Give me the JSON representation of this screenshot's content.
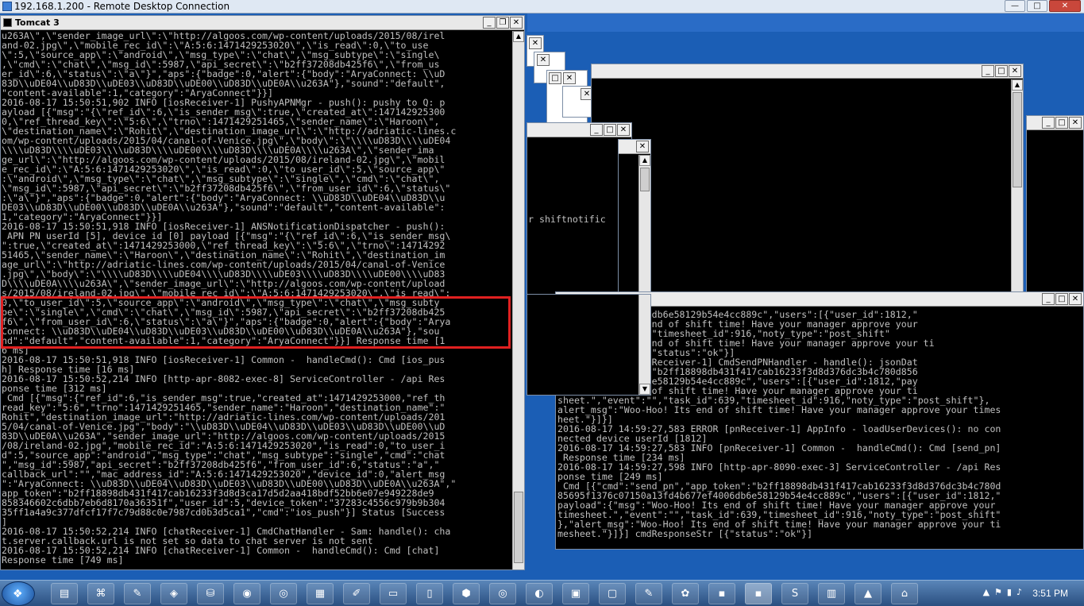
{
  "rdp": {
    "title": "192.168.1.200 - Remote Desktop Connection",
    "min_label": "—",
    "max_label": "□",
    "close_label": "✕"
  },
  "main_window": {
    "title": "Tomcat 3",
    "lines": [
      "u263A\\\",\\\"sender_image_url\\\":\\\"http://algoos.com/wp-content/uploads/2015/08/irel",
      "and-02.jpg\\\",\\\"mobile_rec_id\\\":\\\"A:5:6:1471429253020\\\",\\\"is_read\\\":0,\\\"to_use",
      "\\\":5,\\\"source_app\\\":\\\"android\\\",\\\"msg_type\\\":\\\"chat\\\",\\\"msg_subtype\\\":\\\"single\\",
      ",\\\"cmd\\\":\\\"chat\\\",\\\"msg_id\\\":5987,\\\"api_secret\\\":\\\"b2ff37208db425f6\\\",\\\"from_us",
      "er_id\\\":6,\\\"status\\\":\\\"a\\\"}\",\"aps\":{\"badge\":0,\"alert\":{\"body\":\"AryaConnect: \\\\uD",
      "83D\\\\uDE04\\\\uD83D\\\\uDE03\\\\uD83D\\\\uDE00\\\\uD83D\\\\uDE0A\\\\u263A\"},\"sound\":\"default\",",
      "\"content-available\":1,\"category\":\"AryaConnect\"}}]",
      "2016-08-17 15:50:51,902 INFO [iosReceiver-1] PushyAPNMgr - push(): pushy to Q: p",
      "ayload [{\"msg\":\"{\\\"ref_id\\\":6,\\\"is_sender_msg\\\":true,\\\"created_at\\\":147142925300",
      "0,\\\"ref_thread_key\\\":\\\"5:6\\\",\\\"trno\\\":1471429251465,\\\"sender_name\\\":\\\"Haroon\\\",",
      "\\\"destination_name\\\":\\\"Rohit\\\",\\\"destination_image_url\\\":\\\"http://adriatic-lines.c",
      "om/wp-content/uploads/2015/04/canal-of-Venice.jpg\\\",\\\"body\\\":\\\"\\\\\\\\uD83D\\\\\\\\uDE04",
      "\\\\\\\\uD83D\\\\\\\\uDE03\\\\\\\\uD83D\\\\\\\\uDE00\\\\\\\\uD83D\\\\\\\\uDE0A\\\\\\\\u263A\\\",\\\"sender_ima",
      "ge_url\\\":\\\"http://algoos.com/wp-content/uploads/2015/08/ireland-02.jpg\\\",\\\"mobil",
      "e_rec_id\\\":\\\"A:5:6:1471429253020\\\",\\\"is_read\\\":0,\\\"to_user_id\\\":5,\\\"source_app\\\"",
      ":\\\"android\\\",\\\"msg_type\\\":\\\"chat\\\",\\\"msg_subtype\\\":\\\"single\\\",\\\"cmd\\\":\\\"chat\\\",",
      "\\\"msg_id\\\":5987,\\\"api_secret\\\":\\\"b2ff37208db425f6\\\",\\\"from_user_id\\\":6,\\\"status\\\"",
      ":\\\"a\\\"}\",\"aps\":{\"badge\":0,\"alert\":{\"body\":\"AryaConnect: \\\\uD83D\\\\uDE04\\\\uD83D\\\\u",
      "DE03\\\\uD83D\\\\uDE00\\\\uD83D\\\\uDE0A\\\\u263A\"},\"sound\":\"default\",\"content-available\":",
      "1,\"category\":\"AryaConnect\"}}]",
      "2016-08-17 15:50:51,918 INFO [iosReceiver-1] ANSNotificationDispatcher - push():",
      " APN PN userId [5], device id [0] payload [{\"msg\":\"{\\\"ref_id\\\":6,\\\"is_sender_msg\\",
      "\":true,\\\"created_at\\\":1471429253000,\\\"ref_thread_key\\\":\\\"5:6\\\",\\\"trno\\\":14714292",
      "51465,\\\"sender_name\\\":\\\"Haroon\\\",\\\"destination_name\\\":\\\"Rohit\\\",\\\"destination_im",
      "age_url\\\":\\\"http://adriatic-lines.com/wp-content/uploads/2015/04/canal-of-Venice",
      ".jpg\\\",\\\"body\\\":\\\"\\\\\\\\uD83D\\\\\\\\uDE04\\\\\\\\uD83D\\\\\\\\uDE03\\\\\\\\uD83D\\\\\\\\uDE00\\\\\\\\uD83",
      "D\\\\\\\\uDE0A\\\\\\\\u263A\\\",\\\"sender_image_url\\\":\\\"http://algoos.com/wp-content/upload",
      "s/2015/08/ireland-02.jpg\\\",\\\"mobile_rec_id\\\":\\\"A:5:6:1471429253020\\\",\\\"is_read\\\":",
      "0,\\\"to_user_id\\\":5,\\\"source_app\\\":\\\"android\\\",\\\"msg_type\\\":\\\"chat\\\",\\\"msg_subty",
      "pe\\\":\\\"single\\\",\\\"cmd\\\":\\\"chat\\\",\\\"msg_id\\\":5987,\\\"api_secret\\\":\\\"b2ff37208db425",
      "f6\\\",\\\"from_user_id\\\":6,\\\"status\\\":\\\"a\\\"}\",\"aps\":{\"badge\":0,\"alert\":{\"body\":\"Arya",
      "Connect: \\\\uD83D\\\\uDE04\\\\uD83D\\\\uDE03\\\\uD83D\\\\uDE00\\\\uD83D\\\\uDE0A\\\\u263A\"},\"sou",
      "nd\":\"default\",\"content-available\":1,\"category\":\"AryaConnect\"}}] Response time [1",
      "6 ms]",
      "2016-08-17 15:50:51,918 INFO [iosReceiver-1] Common -  handleCmd(): Cmd [ios_pus",
      "h] Response time [16 ms]",
      "2016-08-17 15:50:52,214 INFO [http-apr-8082-exec-8] ServiceController - /api Res",
      "ponse time [312 ms]",
      " Cmd [{\"msg\":{\"ref_id\":6,\"is_sender_msg\":true,\"created_at\":1471429253000,\"ref_th",
      "read_key\":\"5:6\",\"trno\":1471429251465,\"sender_name\":\"Haroon\",\"destination_name\":\"",
      "Rohit\",\"destination_image_url\":\"http://adriatic-lines.com/wp-content/uploads/201",
      "5/04/canal-of-Venice.jpg\",\"body\":\"\\\\uD83D\\\\uDE04\\\\uD83D\\\\uDE03\\\\uD83D\\\\uDE00\\\\uD",
      "83D\\\\uDE0A\\\\u263A\",\"sender_image_url\":\"http://algoos.com/wp-content/uploads/2015",
      "/08/ireland-02.jpg\",\"mobile_rec_id\":\"A:5:6:1471429253020\",\"is_read\":0,\"to_user_i",
      "d\":5,\"source_app\":\"android\",\"msg_type\":\"chat\",\"msg_subtype\":\"single\",\"cmd\":\"chat",
      "\",\"msg_id\":5987,\"api_secret\":\"b2ff37208db425f6\",\"from_user_id\":6,\"status\":\"a\",\"",
      "callback_url\":\"\",\"mac_address_id\":\"A:5:6:1471429253020\",\"device_id\":0,\"alert_msg",
      "\":\"AryaConnect: \\\\uD83D\\\\uDE04\\\\uD83D\\\\uDE03\\\\uD83D\\\\uDE00\\\\uD83D\\\\uDE0A\\\\u263A\",\"",
      "app_token\":\"b2ff18898db431f417cab16233f3d8d3ca17d5d2aa418bdf52bb6e07e949228de9",
      "858346602c6dbb7eb6d8170a36351f\",\"user_id\":5,\"device_token\":\"37283c4556c979b9b304",
      "35ff1a4a9c377dfcf17f7c79d88c0e7987cd0b3d5ca1\",\"cmd\":\"ios_push\"}] Status [Success",
      "]",
      "2016-08-17 15:50:52,214 INFO [chatReceiver-1] CmdChatHandler - Sam: handle(): cha",
      "t.server.callback.url is not set so data to chat server is not sent",
      "2016-08-17 15:50:52,214 INFO [chatReceiver-1] Common -  handleCmd(): Cmd [chat]",
      "Response time [749 ms]"
    ]
  },
  "right_window": {
    "lines": [
      "0a13fd4b677ef4006db6e58129b54e4cc889c\",\"users\":[{\"user_id\":1812,\"",
      "\":\"Woo-Hoo! Its end of shift time! Have your manager approve your",
      "e\",\"task_id\":639,\"timesheet_id\":916,\"noty_type\":\"post_shift\"",
      "\":\"Woo-Hoo! Its end of shift time! Have your manager approve your ti",
      "cmdResponseStr [{\"status\":\"ok\"}]",
      "9:27,349 INFO [pnReceiver-1] CmdSendPNHandler - handle(): jsonDat",
      "_pn\",\"app_token\":\"b2ff18898db431f417cab16233f3d8d376dc3b4c780d856",
      "3fd4b677ef4006db6e58129b54e4cc889c\",\"users\":[{\"user_id\":1812,\"pay",
      "Woo-Hoo! Its end of shift time! Have your manager approve your ti",
      "sheet.\",\"event\":\"\",\"task_id\":639,\"timesheet_id\":916,\"noty_type\":\"post_shift\"},",
      "alert_msg\":\"Woo-Hoo! Its end of shift time! Have your manager approve your times",
      "heet.\"}]}]",
      "2016-08-17 14:59:27,583 ERROR [pnReceiver-1] AppInfo - loadUserDevices(): no con",
      "nected device userId [1812]",
      "2016-08-17 14:59:27,583 INFO [pnReceiver-1] Common -  handleCmd(): Cmd [send_pn]",
      " Response time [234 ms]",
      "2016-08-17 14:59:27,598 INFO [http-apr-8090-exec-3] ServiceController - /api Res",
      "ponse time [249 ms]",
      " Cmd [{\"cmd\":\"send_pn\",\"app_token\":\"b2ff18898db431f417cab16233f3d8d376dc3b4c780d",
      "85695f1376c07150a13fd4b677ef4006db6e58129b54e4cc889c\",\"users\":[{\"user_id\":1812,\"",
      "payload\":{\"msg\":\"Woo-Hoo! Its end of shift time! Have your manager approve your",
      "timesheet.\",\"event\":\"\",\"task_id\":639,\"timesheet_id\":916,\"noty_type\":\"post_shift\"",
      "},\"alert_msg\":\"Woo-Hoo! Its end of shift time! Have your manager approve your ti",
      "mesheet.\"}]}] cmdResponseStr [{\"status\":\"ok\"}]"
    ]
  },
  "mid_window": {
    "text": "r shiftnotific"
  },
  "taskbar": {
    "clock": "3:51 PM",
    "start_label": "❖"
  },
  "colors": {
    "console_text": "#c0c0c0",
    "console_bg": "#000000",
    "highlight": "#e02020",
    "desktop": "#1b5eb5"
  }
}
